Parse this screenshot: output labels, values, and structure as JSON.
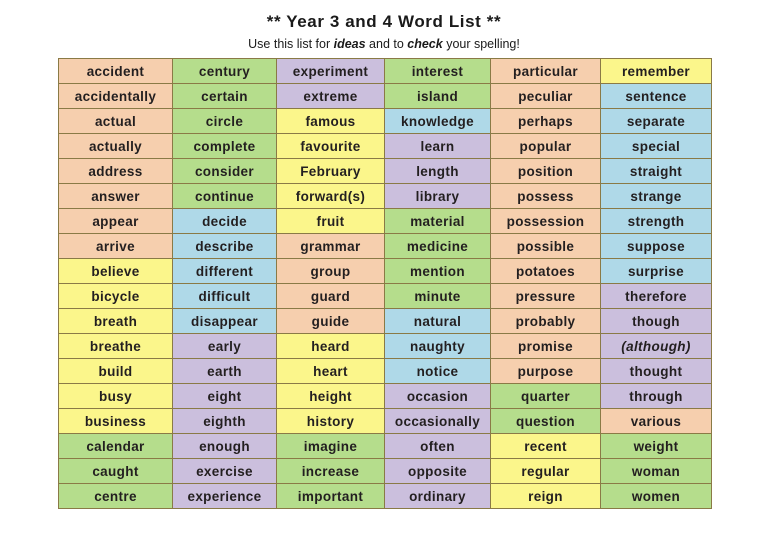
{
  "header": {
    "title": "** Year 3 and 4 Word List **",
    "subtitle_parts": {
      "before": "Use this list for ",
      "em1": "ideas",
      "middle": " and to ",
      "em2": "check",
      "after": " your spelling!"
    }
  },
  "palette": {
    "peach": "#f6cfae",
    "green": "#b5dd8c",
    "yellow": "#fbf68b",
    "blue": "#afd9e8",
    "purple": "#cbbfdd",
    "text": "#231f20",
    "page_background": "#ffffff"
  },
  "table": {
    "columns": 6,
    "rows": 18,
    "cells": [
      [
        {
          "word": "accident",
          "color": "peach"
        },
        {
          "word": "century",
          "color": "green"
        },
        {
          "word": "experiment",
          "color": "purple"
        },
        {
          "word": "interest",
          "color": "green"
        },
        {
          "word": "particular",
          "color": "peach"
        },
        {
          "word": "remember",
          "color": "yellow"
        }
      ],
      [
        {
          "word": "accidentally",
          "color": "peach"
        },
        {
          "word": "certain",
          "color": "green"
        },
        {
          "word": "extreme",
          "color": "purple"
        },
        {
          "word": "island",
          "color": "green"
        },
        {
          "word": "peculiar",
          "color": "peach"
        },
        {
          "word": "sentence",
          "color": "blue"
        }
      ],
      [
        {
          "word": "actual",
          "color": "peach"
        },
        {
          "word": "circle",
          "color": "green"
        },
        {
          "word": "famous",
          "color": "yellow"
        },
        {
          "word": "knowledge",
          "color": "blue"
        },
        {
          "word": "perhaps",
          "color": "peach"
        },
        {
          "word": "separate",
          "color": "blue"
        }
      ],
      [
        {
          "word": "actually",
          "color": "peach"
        },
        {
          "word": "complete",
          "color": "green"
        },
        {
          "word": "favourite",
          "color": "yellow"
        },
        {
          "word": "learn",
          "color": "purple"
        },
        {
          "word": "popular",
          "color": "peach"
        },
        {
          "word": "special",
          "color": "blue"
        }
      ],
      [
        {
          "word": "address",
          "color": "peach"
        },
        {
          "word": "consider",
          "color": "green"
        },
        {
          "word": "February",
          "color": "yellow"
        },
        {
          "word": "length",
          "color": "purple"
        },
        {
          "word": "position",
          "color": "peach"
        },
        {
          "word": "straight",
          "color": "blue"
        }
      ],
      [
        {
          "word": "answer",
          "color": "peach"
        },
        {
          "word": "continue",
          "color": "green"
        },
        {
          "word": "forward(s)",
          "color": "yellow"
        },
        {
          "word": "library",
          "color": "purple"
        },
        {
          "word": "possess",
          "color": "peach"
        },
        {
          "word": "strange",
          "color": "blue"
        }
      ],
      [
        {
          "word": "appear",
          "color": "peach"
        },
        {
          "word": "decide",
          "color": "blue"
        },
        {
          "word": "fruit",
          "color": "yellow"
        },
        {
          "word": "material",
          "color": "green"
        },
        {
          "word": "possession",
          "color": "peach"
        },
        {
          "word": "strength",
          "color": "blue"
        }
      ],
      [
        {
          "word": "arrive",
          "color": "peach"
        },
        {
          "word": "describe",
          "color": "blue"
        },
        {
          "word": "grammar",
          "color": "peach"
        },
        {
          "word": "medicine",
          "color": "green"
        },
        {
          "word": "possible",
          "color": "peach"
        },
        {
          "word": "suppose",
          "color": "blue"
        }
      ],
      [
        {
          "word": "believe",
          "color": "yellow"
        },
        {
          "word": "different",
          "color": "blue"
        },
        {
          "word": "group",
          "color": "peach"
        },
        {
          "word": "mention",
          "color": "green"
        },
        {
          "word": "potatoes",
          "color": "peach"
        },
        {
          "word": "surprise",
          "color": "blue"
        }
      ],
      [
        {
          "word": "bicycle",
          "color": "yellow"
        },
        {
          "word": "difficult",
          "color": "blue"
        },
        {
          "word": "guard",
          "color": "peach"
        },
        {
          "word": "minute",
          "color": "green"
        },
        {
          "word": "pressure",
          "color": "peach"
        },
        {
          "word": "therefore",
          "color": "purple"
        }
      ],
      [
        {
          "word": "breath",
          "color": "yellow"
        },
        {
          "word": "disappear",
          "color": "blue"
        },
        {
          "word": "guide",
          "color": "peach"
        },
        {
          "word": "natural",
          "color": "blue"
        },
        {
          "word": "probably",
          "color": "peach"
        },
        {
          "word": "though",
          "color": "purple"
        }
      ],
      [
        {
          "word": "breathe",
          "color": "yellow"
        },
        {
          "word": "early",
          "color": "purple"
        },
        {
          "word": "heard",
          "color": "yellow"
        },
        {
          "word": "naughty",
          "color": "blue"
        },
        {
          "word": "promise",
          "color": "peach"
        },
        {
          "word": "(although)",
          "color": "purple",
          "italic": true
        }
      ],
      [
        {
          "word": "build",
          "color": "yellow"
        },
        {
          "word": "earth",
          "color": "purple"
        },
        {
          "word": "heart",
          "color": "yellow"
        },
        {
          "word": "notice",
          "color": "blue"
        },
        {
          "word": "purpose",
          "color": "peach"
        },
        {
          "word": "thought",
          "color": "purple"
        }
      ],
      [
        {
          "word": "busy",
          "color": "yellow"
        },
        {
          "word": "eight",
          "color": "purple"
        },
        {
          "word": "height",
          "color": "yellow"
        },
        {
          "word": "occasion",
          "color": "purple"
        },
        {
          "word": "quarter",
          "color": "green"
        },
        {
          "word": "through",
          "color": "purple"
        }
      ],
      [
        {
          "word": "business",
          "color": "yellow"
        },
        {
          "word": "eighth",
          "color": "purple"
        },
        {
          "word": "history",
          "color": "yellow"
        },
        {
          "word": "occasionally",
          "color": "purple"
        },
        {
          "word": "question",
          "color": "green"
        },
        {
          "word": "various",
          "color": "peach"
        }
      ],
      [
        {
          "word": "calendar",
          "color": "green"
        },
        {
          "word": "enough",
          "color": "purple"
        },
        {
          "word": "imagine",
          "color": "green"
        },
        {
          "word": "often",
          "color": "purple"
        },
        {
          "word": "recent",
          "color": "yellow"
        },
        {
          "word": "weight",
          "color": "green"
        }
      ],
      [
        {
          "word": "caught",
          "color": "green"
        },
        {
          "word": "exercise",
          "color": "purple"
        },
        {
          "word": "increase",
          "color": "green"
        },
        {
          "word": "opposite",
          "color": "purple"
        },
        {
          "word": "regular",
          "color": "yellow"
        },
        {
          "word": "woman",
          "color": "green"
        }
      ],
      [
        {
          "word": "centre",
          "color": "green"
        },
        {
          "word": "experience",
          "color": "purple"
        },
        {
          "word": "important",
          "color": "green"
        },
        {
          "word": "ordinary",
          "color": "purple"
        },
        {
          "word": "reign",
          "color": "yellow"
        },
        {
          "word": "women",
          "color": "green"
        }
      ]
    ]
  }
}
